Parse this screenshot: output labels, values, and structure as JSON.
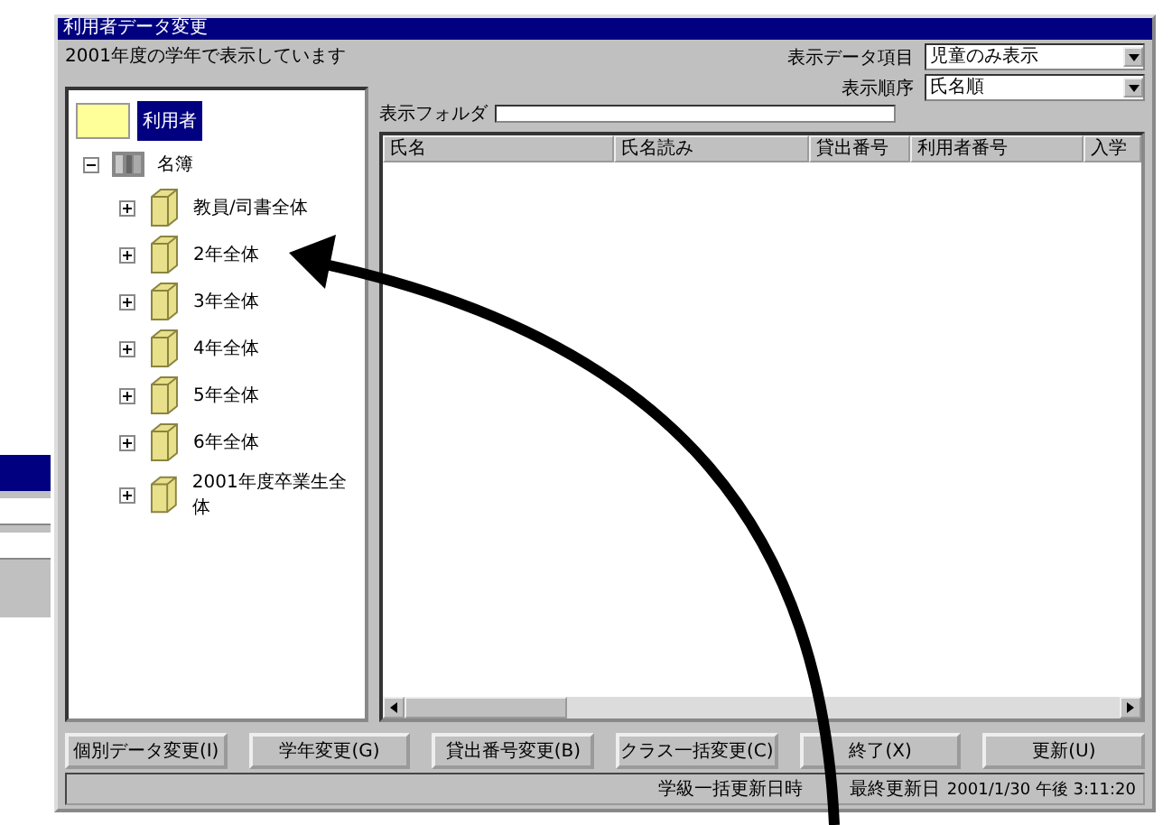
{
  "window": {
    "title": "利用者データ変更"
  },
  "header": {
    "note": "2001年度の学年で表示しています",
    "display_item_label": "表示データ項目",
    "display_item_value": "児童のみ表示",
    "sort_label": "表示順序",
    "sort_value": "氏名順"
  },
  "tree": {
    "root": {
      "label": "利用者",
      "selected": true
    },
    "items": [
      {
        "label": "名簿",
        "expanded": true,
        "children": [
          {
            "label": "教員/司書全体",
            "expanded": false
          },
          {
            "label": "2年全体",
            "expanded": false
          },
          {
            "label": "3年全体",
            "expanded": false
          },
          {
            "label": "4年全体",
            "expanded": false
          },
          {
            "label": "5年全体",
            "expanded": false
          },
          {
            "label": "6年全体",
            "expanded": false
          },
          {
            "label": "2001年度卒業生全体",
            "expanded": false
          }
        ]
      }
    ]
  },
  "folder_field": {
    "label": "表示フォルダ"
  },
  "table": {
    "columns": [
      "氏名",
      "氏名読み",
      "貸出番号",
      "利用者番号",
      "入学"
    ]
  },
  "buttons": [
    "個別データ変更(I)",
    "学年変更(G)",
    "貸出番号変更(B)",
    "クラス一括変更(C)",
    "終了(X)",
    "更新(U)"
  ],
  "status_bar": {
    "label": "学級一括更新日時",
    "updated_label": "最終更新日",
    "timestamp": "2001/1/30 午後 3:11:20"
  }
}
